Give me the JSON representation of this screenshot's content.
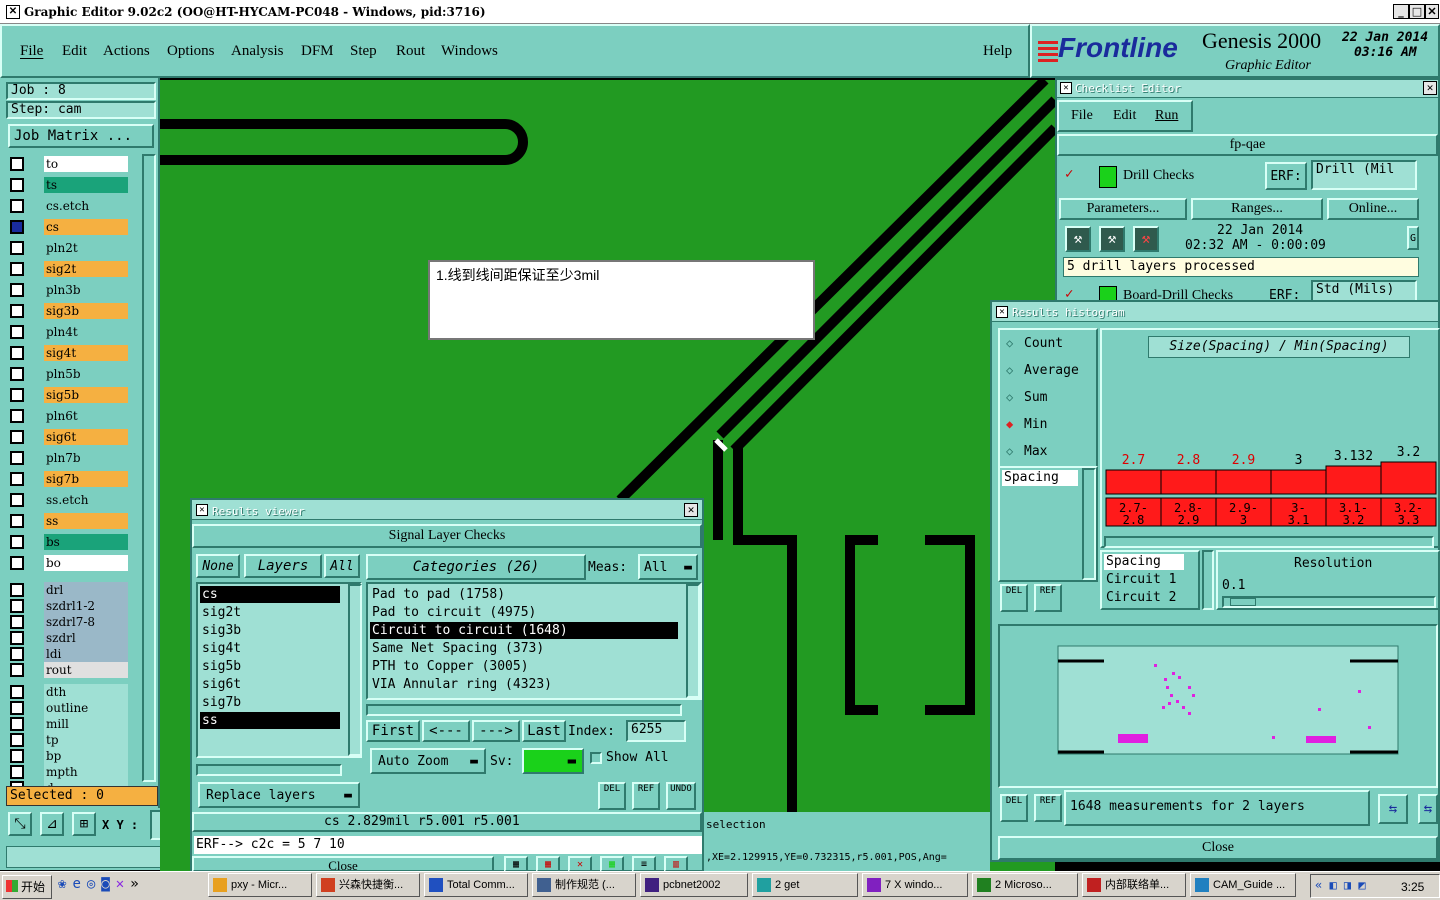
{
  "window": {
    "title": "Graphic Editor 9.02c2  (OO@HT-HYCAM-PC048 - Windows, pid:3716)"
  },
  "menu": {
    "items": [
      "File",
      "Edit",
      "Actions",
      "Options",
      "Analysis",
      "DFM",
      "Step",
      "Rout",
      "Windows"
    ],
    "help": "Help"
  },
  "brand": {
    "logo": "Frontline",
    "product": "Genesis 2000",
    "sub": "Graphic Editor",
    "date": "22 Jan 2014",
    "time": "03:16 AM"
  },
  "job": {
    "job_label": "Job : 8",
    "step_label": "Step: cam",
    "matrix_btn": "Job Matrix ..."
  },
  "layers": [
    {
      "name": "to",
      "color": "#ffffff"
    },
    {
      "name": "ts",
      "color": "#1aa37a"
    },
    {
      "name": "cs.etch",
      "color": "#7ccfc0"
    },
    {
      "name": "cs",
      "color": "#f5b041"
    },
    {
      "name": "pln2t",
      "color": "#7ccfc0"
    },
    {
      "name": "sig2t",
      "color": "#f5b041"
    },
    {
      "name": "pln3b",
      "color": "#7ccfc0"
    },
    {
      "name": "sig3b",
      "color": "#f5b041"
    },
    {
      "name": "pln4t",
      "color": "#7ccfc0"
    },
    {
      "name": "sig4t",
      "color": "#f5b041"
    },
    {
      "name": "pln5b",
      "color": "#7ccfc0"
    },
    {
      "name": "sig5b",
      "color": "#f5b041"
    },
    {
      "name": "pln6t",
      "color": "#7ccfc0"
    },
    {
      "name": "sig6t",
      "color": "#f5b041"
    },
    {
      "name": "pln7b",
      "color": "#7ccfc0"
    },
    {
      "name": "sig7b",
      "color": "#f5b041"
    },
    {
      "name": "ss.etch",
      "color": "#7ccfc0"
    },
    {
      "name": "ss",
      "color": "#f5b041"
    },
    {
      "name": "bs",
      "color": "#1aa37a"
    },
    {
      "name": "bo",
      "color": "#ffffff"
    },
    {
      "name": "drl",
      "color": "#9ab8c8"
    },
    {
      "name": "szdrl1-2",
      "color": "#9ab8c8"
    },
    {
      "name": "szdrl7-8",
      "color": "#9ab8c8"
    },
    {
      "name": "szdrl",
      "color": "#9ab8c8"
    },
    {
      "name": "ldi",
      "color": "#9ab8c8"
    },
    {
      "name": "rout",
      "color": "#e0e0e0"
    },
    {
      "name": "dth",
      "color": "#9fe0d4"
    },
    {
      "name": "outline",
      "color": "#9fe0d4"
    },
    {
      "name": "mill",
      "color": "#9fe0d4"
    },
    {
      "name": "tp",
      "color": "#9fe0d4"
    },
    {
      "name": "bp",
      "color": "#9fe0d4"
    },
    {
      "name": "mpth",
      "color": "#9fe0d4"
    },
    {
      "name": "d",
      "color": "#9fe0d4"
    }
  ],
  "selected": "Selected : 0",
  "xy_label": "X Y :",
  "note": "1.线到线间距保证至少3mil",
  "checklist": {
    "title": "Checklist Editor",
    "menu": [
      "File",
      "Edit",
      "Run"
    ],
    "name": "fp-qae",
    "check1": {
      "label": "Drill Checks",
      "erf": "ERF:",
      "erf_val": "Drill (Mil",
      "date": "22 Jan 2014",
      "time": "02:32 AM - 0:00:09",
      "status": "5 drill layers processed"
    },
    "buttons": [
      "Parameters...",
      "Ranges...",
      "Online..."
    ],
    "check2": {
      "label": "Board-Drill Checks",
      "erf": "ERF:",
      "erf_val": "Std (Mils)"
    }
  },
  "histogram": {
    "title": "Results histogram",
    "options": [
      "Count",
      "Average",
      "Sum",
      "Min",
      "Max"
    ],
    "selected_option": "Min",
    "heading": "Size(Spacing) / Min(Spacing)",
    "list": [
      "Spacing"
    ],
    "list2": [
      "Spacing",
      "Circuit 1",
      "Circuit 2"
    ],
    "resolution_label": "Resolution",
    "resolution": "0.1",
    "footer": "1648 measurements for 2 layers",
    "close": "Close",
    "del": "DEL",
    "ref": "REF"
  },
  "chart_data": {
    "type": "bar",
    "categories": [
      "2.7-2.8",
      "2.8-2.9",
      "2.9-3",
      "3-3.1",
      "3.1-3.2",
      "3.2-3.3"
    ],
    "values": [
      2.7,
      2.8,
      2.9,
      3,
      3.132,
      3.2
    ],
    "value_labels": [
      "2.7",
      "2.8",
      "2.9",
      "3",
      "3.132",
      "3.2"
    ],
    "title": "Size(Spacing) / Min(Spacing)"
  },
  "results": {
    "title": "Results viewer",
    "header": "Signal Layer Checks",
    "none": "None",
    "layers_btn": "Layers",
    "all": "All",
    "categories_btn": "Categories (26)",
    "meas_label": "Meas:",
    "meas_val": "All",
    "layer_list": [
      "cs",
      "sig2t",
      "sig3b",
      "sig4t",
      "sig5b",
      "sig6t",
      "sig7b",
      "ss"
    ],
    "category_list": [
      "Pad to pad (1758)",
      "Pad to circuit (4975)",
      "Circuit to circuit (1648)",
      "Same Net Spacing (373)",
      "PTH to Copper (3005)",
      "VIA Annular ring (4323)"
    ],
    "selected_category": 2,
    "first": "First",
    "prev": "<---",
    "next": "--->",
    "last": "Last",
    "index_label": "Index:",
    "index_val": "6255",
    "auto_zoom": "Auto Zoom",
    "sv": "Sv:",
    "show_all": "Show All",
    "replace": "Replace layers",
    "del": "DEL",
    "ref": "REF",
    "undo": "UNDO",
    "measure": "cs 2.829mil   r5.001   r5.001",
    "erf": "ERF--> c2c = 5 7 10",
    "close": "Close"
  },
  "status": {
    "selection": "selection",
    "coords": ",XE=2.129915,YE=0.732315,r5.001,POS,Ang="
  },
  "taskbar": {
    "start": "开始",
    "items": [
      "pxy - Micr...",
      "兴森快捷衡...",
      "Total Comm...",
      "制作规范 (...",
      "pcbnet2002",
      "2 get",
      "7 X windo...",
      "2 Microso...",
      "内部联络单...",
      "CAM_Guide ..."
    ],
    "clock": "3:25"
  }
}
